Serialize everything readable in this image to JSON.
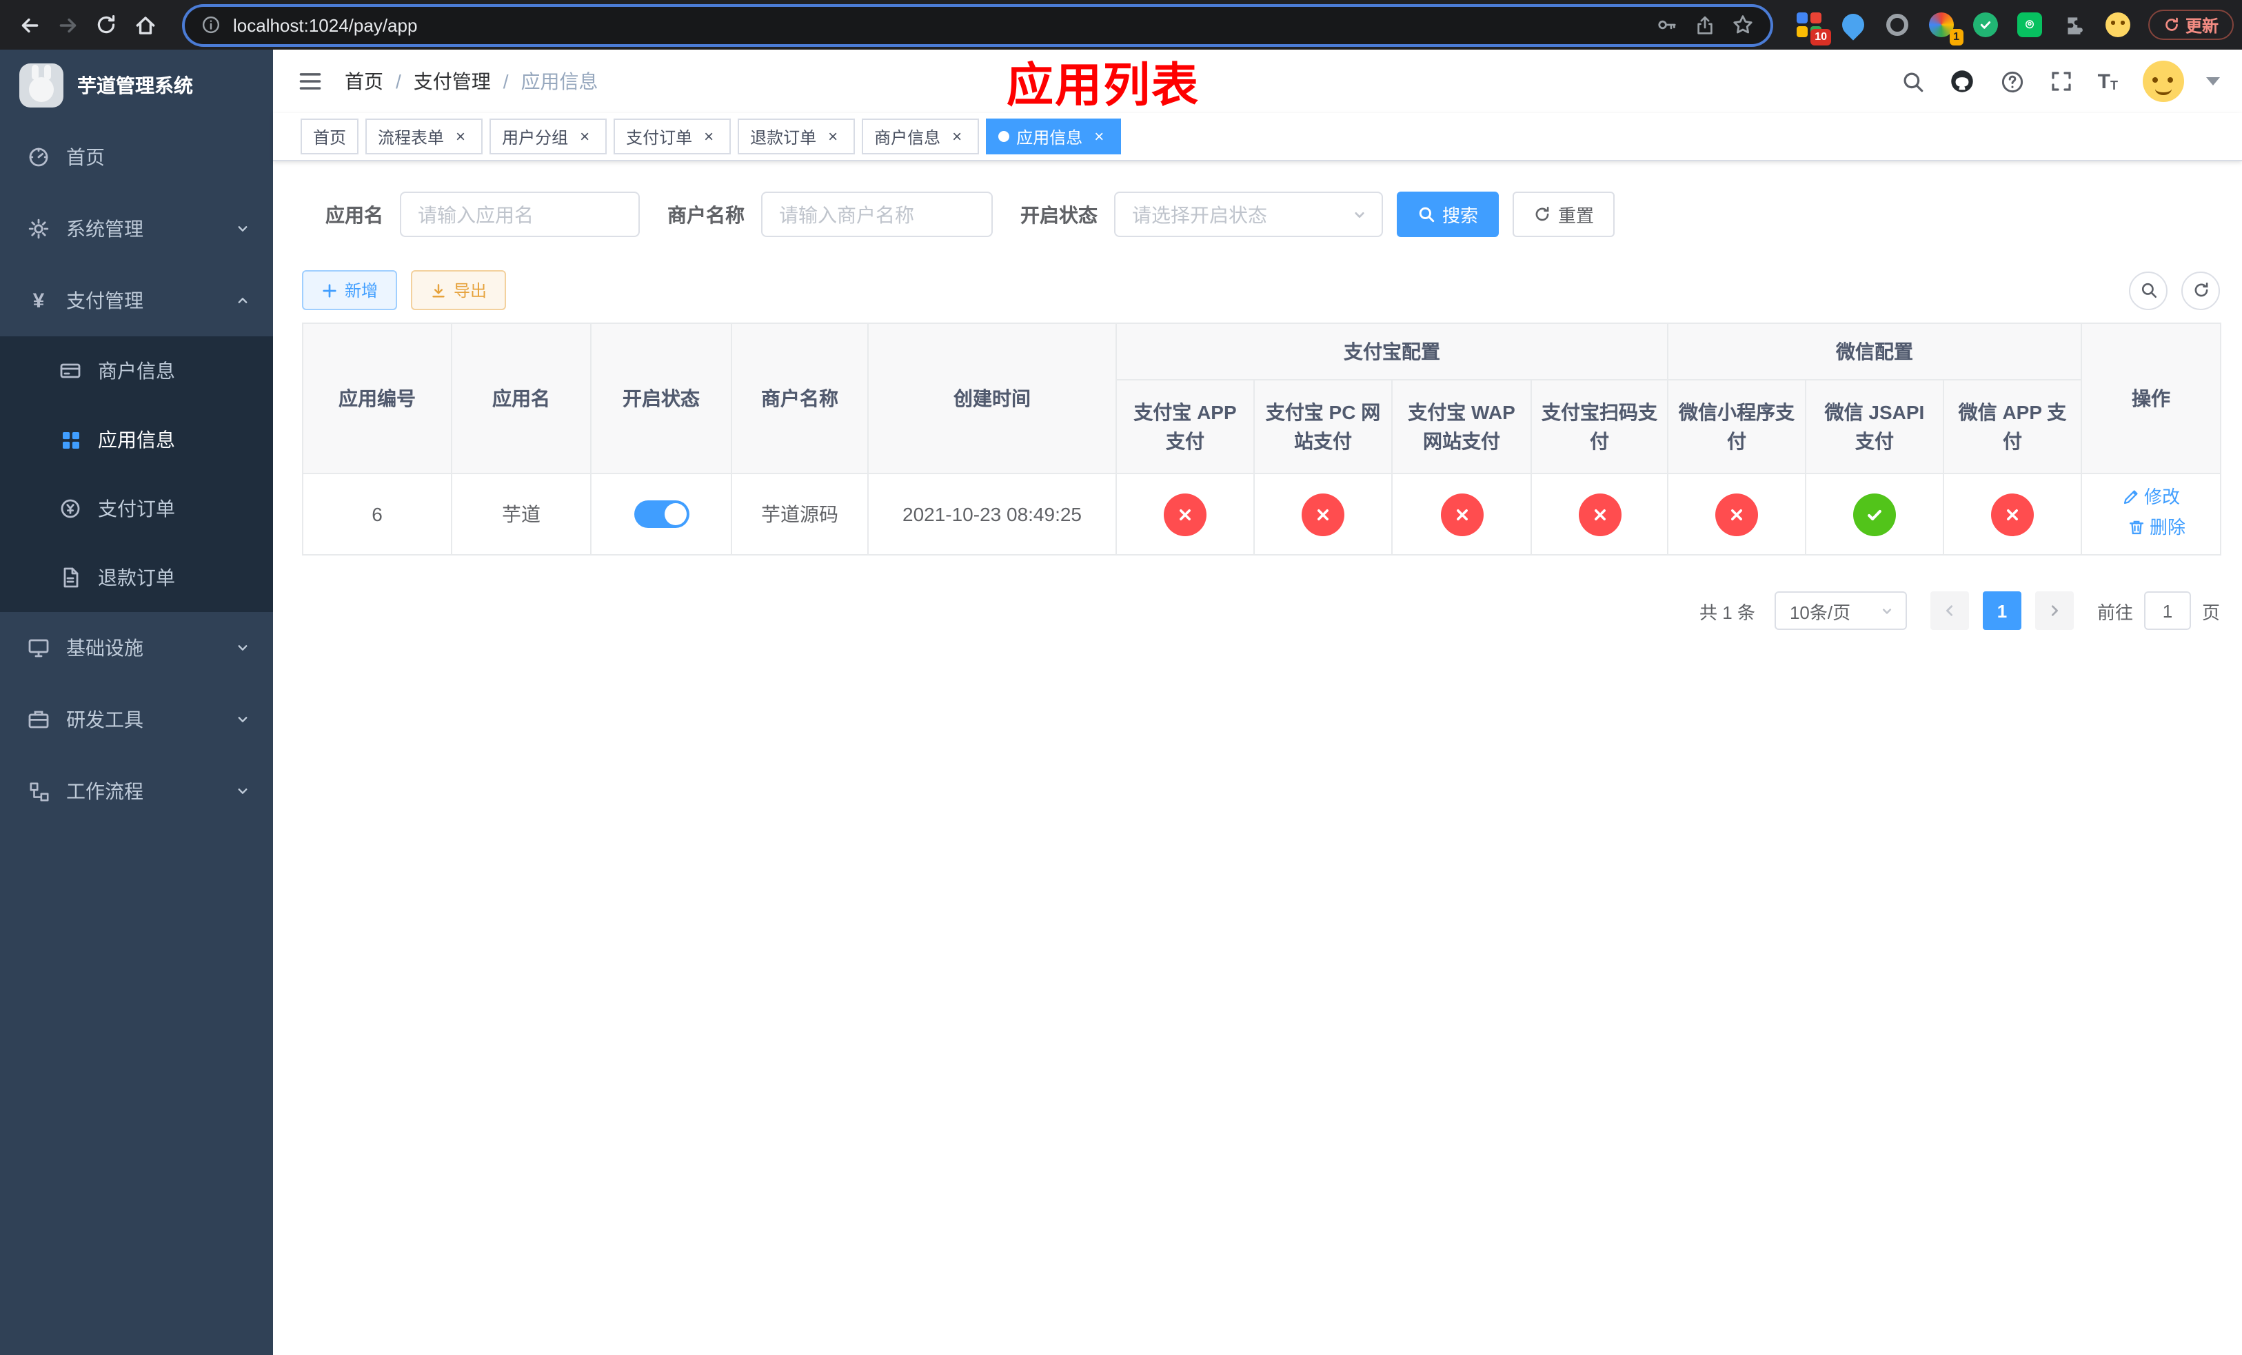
{
  "colors": {
    "accent_blue": "#409eff",
    "status_fail_red": "#ff4d4f",
    "status_ok_green": "#52c41a",
    "annotation_red": "#fe0000",
    "export_yellow": "#e6a23c",
    "sidebar_bg": "#304156",
    "submenu_bg": "#1f2d3d"
  },
  "browser": {
    "url": "localhost:1024/pay/app",
    "update_label": "更新",
    "badges": {
      "extensions_grid": "10",
      "translate_ext": "1"
    }
  },
  "sidebar": {
    "app_title": "芋道管理系统",
    "menu": [
      {
        "label": "首页"
      },
      {
        "label": "系统管理"
      },
      {
        "label": "支付管理",
        "children": [
          {
            "label": "商户信息"
          },
          {
            "label": "应用信息"
          },
          {
            "label": "支付订单"
          },
          {
            "label": "退款订单"
          }
        ]
      },
      {
        "label": "基础设施"
      },
      {
        "label": "研发工具"
      },
      {
        "label": "工作流程"
      }
    ]
  },
  "topbar": {
    "breadcrumb": [
      {
        "label": "首页"
      },
      {
        "label": "支付管理"
      },
      {
        "label": "应用信息"
      }
    ],
    "annotation": "应用列表"
  },
  "tags": [
    {
      "label": "首页"
    },
    {
      "label": "流程表单"
    },
    {
      "label": "用户分组"
    },
    {
      "label": "支付订单"
    },
    {
      "label": "退款订单"
    },
    {
      "label": "商户信息"
    },
    {
      "label": "应用信息"
    }
  ],
  "filter": {
    "app_name": {
      "label": "应用名",
      "placeholder": "请输入应用名"
    },
    "merchant_name": {
      "label": "商户名称",
      "placeholder": "请输入商户名称"
    },
    "status": {
      "label": "开启状态",
      "placeholder": "请选择开启状态"
    },
    "search_label": "搜索",
    "reset_label": "重置"
  },
  "toolbar": {
    "add_label": "新增",
    "export_label": "导出"
  },
  "table": {
    "headers": {
      "app_id": "应用编号",
      "app_name": "应用名",
      "status": "开启状态",
      "merchant": "商户名称",
      "created": "创建时间",
      "alipay_group": "支付宝配置",
      "wechat_group": "微信配置",
      "alipay_app": "支付宝 APP 支付",
      "alipay_pc": "支付宝 PC 网站支付",
      "alipay_wap": "支付宝 WAP 网站支付",
      "alipay_qr": "支付宝扫码支付",
      "wechat_mini": "微信小程序支付",
      "wechat_jsapi": "微信 JSAPI 支付",
      "wechat_app": "微信 APP 支付",
      "actions": "操作"
    },
    "rows": [
      {
        "app_id": "6",
        "app_name": "芋道",
        "enabled": true,
        "merchant": "芋道源码",
        "created": "2021-10-23 08:49:25",
        "configs": [
          false,
          false,
          false,
          false,
          false,
          true,
          false
        ],
        "edit_label": "修改",
        "delete_label": "删除"
      }
    ]
  },
  "pagination": {
    "total": "共 1 条",
    "page_size": "10条/页",
    "current_page": "1",
    "goto_label": "前往",
    "goto_value": "1",
    "page_unit": "页"
  }
}
